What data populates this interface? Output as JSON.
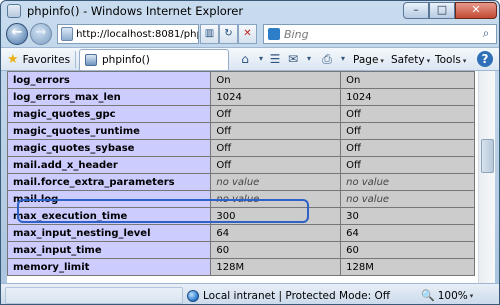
{
  "window": {
    "title": "phpinfo() - Windows Internet Explorer",
    "minimize": "–",
    "maximize": "□",
    "close": "✕"
  },
  "navbar": {
    "address": "http://localhost:8081/phpinfo",
    "search_placeholder": "Bing",
    "refresh_icon": "↻",
    "stop_icon": "✕",
    "compat_icon": "▥",
    "search_icon": "⌕"
  },
  "favbar": {
    "favorites_label": "Favorites",
    "tab_title": "phpinfo()",
    "commands": {
      "page": "Page",
      "safety": "Safety",
      "tools": "Tools",
      "help": "?"
    },
    "icons": {
      "home": "⌂",
      "feeds": "☰",
      "mail": "✉",
      "print": "⎙",
      "dropdown": "▾"
    }
  },
  "table": {
    "rows": [
      {
        "directive": "log_errors",
        "local": "On",
        "master": "On"
      },
      {
        "directive": "log_errors_max_len",
        "local": "1024",
        "master": "1024"
      },
      {
        "directive": "magic_quotes_gpc",
        "local": "Off",
        "master": "Off"
      },
      {
        "directive": "magic_quotes_runtime",
        "local": "Off",
        "master": "Off"
      },
      {
        "directive": "magic_quotes_sybase",
        "local": "Off",
        "master": "Off"
      },
      {
        "directive": "mail.add_x_header",
        "local": "Off",
        "master": "Off"
      },
      {
        "directive": "mail.force_extra_parameters",
        "local": "no value",
        "master": "no value"
      },
      {
        "directive": "mail.log",
        "local": "no value",
        "master": "no value"
      },
      {
        "directive": "max_execution_time",
        "local": "300",
        "master": "30"
      },
      {
        "directive": "max_input_nesting_level",
        "local": "64",
        "master": "64"
      },
      {
        "directive": "max_input_time",
        "local": "60",
        "master": "60"
      },
      {
        "directive": "memory_limit",
        "local": "128M",
        "master": "128M"
      }
    ]
  },
  "statusbar": {
    "zone": "Local intranet | Protected Mode: Off",
    "zoom": "100%"
  },
  "colors": {
    "directive_cell": "#ccccff",
    "value_cell": "#cccccc",
    "highlight": "#2f62c8"
  }
}
